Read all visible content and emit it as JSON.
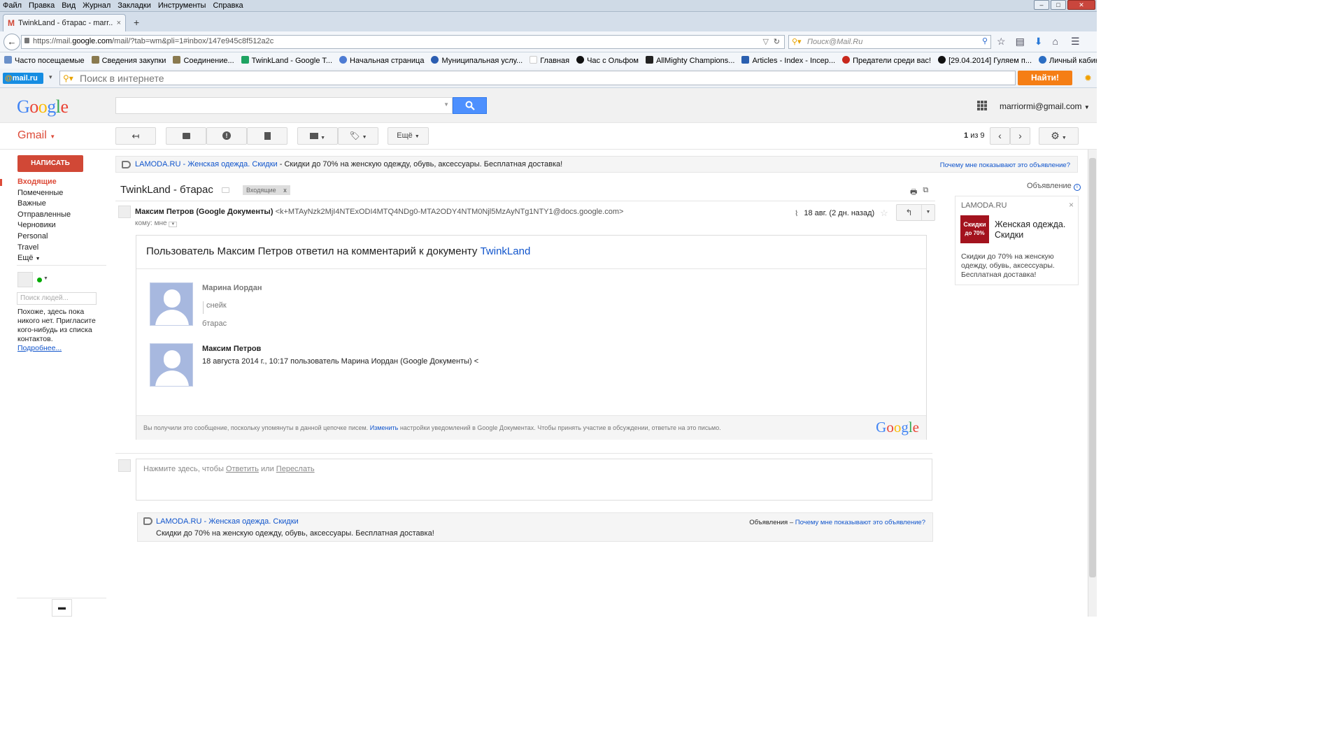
{
  "browser": {
    "menu": [
      "Файл",
      "Правка",
      "Вид",
      "Журнал",
      "Закладки",
      "Инструменты",
      "Справка"
    ],
    "tab_title": "TwinkLand - бтарас - marr...",
    "url_prefix": "https://mail.",
    "url_domain": "google.com",
    "url_rest": "/mail/?tab=wm&pli=1#inbox/147e945c8f512a2c",
    "search_placeholder": "Поиск@Mail.Ru",
    "bookmarks": [
      "Часто посещаемые",
      "Сведения закупки",
      "Соединение...",
      "TwinkLand - Google T...",
      "Начальная страница",
      "Муниципальная услу...",
      "Главная",
      "Час с Ольфом",
      "AllMighty Champions...",
      "Articles - Index - Incep...",
      "Предатели среди вас!",
      "[29.04.2014] Гуляем п...",
      "Личный кабинет \"Рос..."
    ]
  },
  "mailru": {
    "logo_at": "@",
    "logo_text": "mail.ru",
    "search_placeholder": "Поиск в интернете",
    "find_button": "Найти!"
  },
  "header": {
    "logo": "Google",
    "account": "marriormi@gmail.com"
  },
  "toolbar": {
    "gmail_label": "Gmail",
    "more": "Ещё",
    "pager_current": "1",
    "pager_text": "из 9"
  },
  "nav": {
    "compose": "НАПИСАТЬ",
    "items": [
      "Входящие",
      "Помеченные",
      "Важные",
      "Отправленные",
      "Черновики",
      "Personal",
      "Travel",
      "Ещё"
    ],
    "people_search": "Поиск людей...",
    "empty_text": "Похоже, здесь пока никого нет. Пригласите кого-нибудь из списка контактов.",
    "more_link": "Подробнее..."
  },
  "ad_top": {
    "link": "LAMODA.RU",
    "dash": " - ",
    "title": "Женская одежда. Скидки",
    "text": " - Скидки до 70% на женскую одежду, обувь, аксессуары. Бесплатная доставка!",
    "why": "Почему мне показывают это объявление?"
  },
  "message": {
    "subject": "TwinkLand - бтарас",
    "label": "Входящие",
    "label_close": "x",
    "sender_name": "Максим Петров (Google Документы)",
    "sender_email": "<k+MTAyNzk2MjI4NTExODI4MTQ4NDg0-MTA2ODY4NTM0Njl5MzAyNTg1NTY1@docs.google.com>",
    "to": "кому: мне",
    "date": "18 авг. (2 дн. назад)"
  },
  "card": {
    "title_text": "Пользователь Максим Петров ответил на комментарий к документу ",
    "title_link": "TwinkLand",
    "c1_name": "Марина Иордан",
    "c1_quote": "снейк",
    "c1_text": "бтарас",
    "c2_name": "Максим Петров",
    "c2_text": "18 августа 2014 г., 10:17 пользователь Марина Иордан (Google Документы) <",
    "footer_text1": "Вы получили это сообщение, поскольку упомянуты в данной цепочке писем. ",
    "footer_link": "Изменить",
    "footer_text2": " настройки уведомлений в Google Документах. Чтобы принять участие в обсуждении, ответьте на это письмо.",
    "footer_logo": "Google"
  },
  "reply": {
    "prefix": "Нажмите здесь, чтобы ",
    "reply": "Ответить",
    "or": " или ",
    "forward": "Переслать"
  },
  "ad_bottom": {
    "link": "LAMODA.RU",
    "dash": " - ",
    "title": "Женская одежда. Скидки",
    "text": "Скидки до 70% на женскую одежду, обувь, аксессуары. Бесплатная доставка!",
    "ads_label": "Объявления – ",
    "why": "Почему мне показывают это объявление?"
  },
  "ad_right": {
    "label": "Объявление",
    "brand": "LAMODA.RU",
    "thumb_line1": "Скидки",
    "thumb_line2": "до 70%",
    "title": "Женская одежда. Скидки",
    "text": "Скидки до 70% на женскую одежду, обувь, аксессуары. Бесплатная доставка!"
  },
  "colors": {
    "gmail_red": "#dd4b39",
    "compose": "#d14836",
    "search_blue": "#4d90fe",
    "link": "#15c",
    "mailru_orange": "#f57e15"
  }
}
